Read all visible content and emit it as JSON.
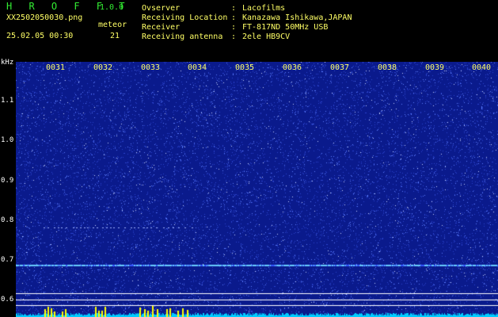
{
  "app": {
    "brand": "H R O F F T",
    "version": "1.0.0"
  },
  "file": {
    "name": "XX2502050030.png",
    "datetime": "25.02.05 00:30"
  },
  "meteor": {
    "label": "meteor",
    "count": "21"
  },
  "info": [
    {
      "label": "Ovserver",
      "value": "Lacofilms"
    },
    {
      "label": "Receiving Location",
      "value": "Kanazawa Ishikawa,JAPAN"
    },
    {
      "label": "Receiver",
      "value": "FT-817ND 50MHz USB"
    },
    {
      "label": "Receiving antenna",
      "value": "2ele HB9CV"
    }
  ],
  "separator": ":",
  "axis": {
    "unit": "kHz",
    "y_ticks": [
      "1.1",
      "1.0",
      "0.9",
      "0.8",
      "0.7",
      "0.6"
    ],
    "x_ticks": [
      "0031",
      "0032",
      "0033",
      "0034",
      "0035",
      "0036",
      "0037",
      "0038",
      "0039",
      "0040"
    ]
  },
  "spectrogram": {
    "y_range_khz": [
      0.58,
      1.19
    ],
    "carrier_khz": 0.705,
    "echo_khz": 0.795,
    "background_color": "#0a1a8c",
    "noise_color": "#5a7cff",
    "carrier_color": "#66ccff",
    "meteor_bar_color": "#ffff00",
    "bottom_trace_color": "#00ccff"
  }
}
